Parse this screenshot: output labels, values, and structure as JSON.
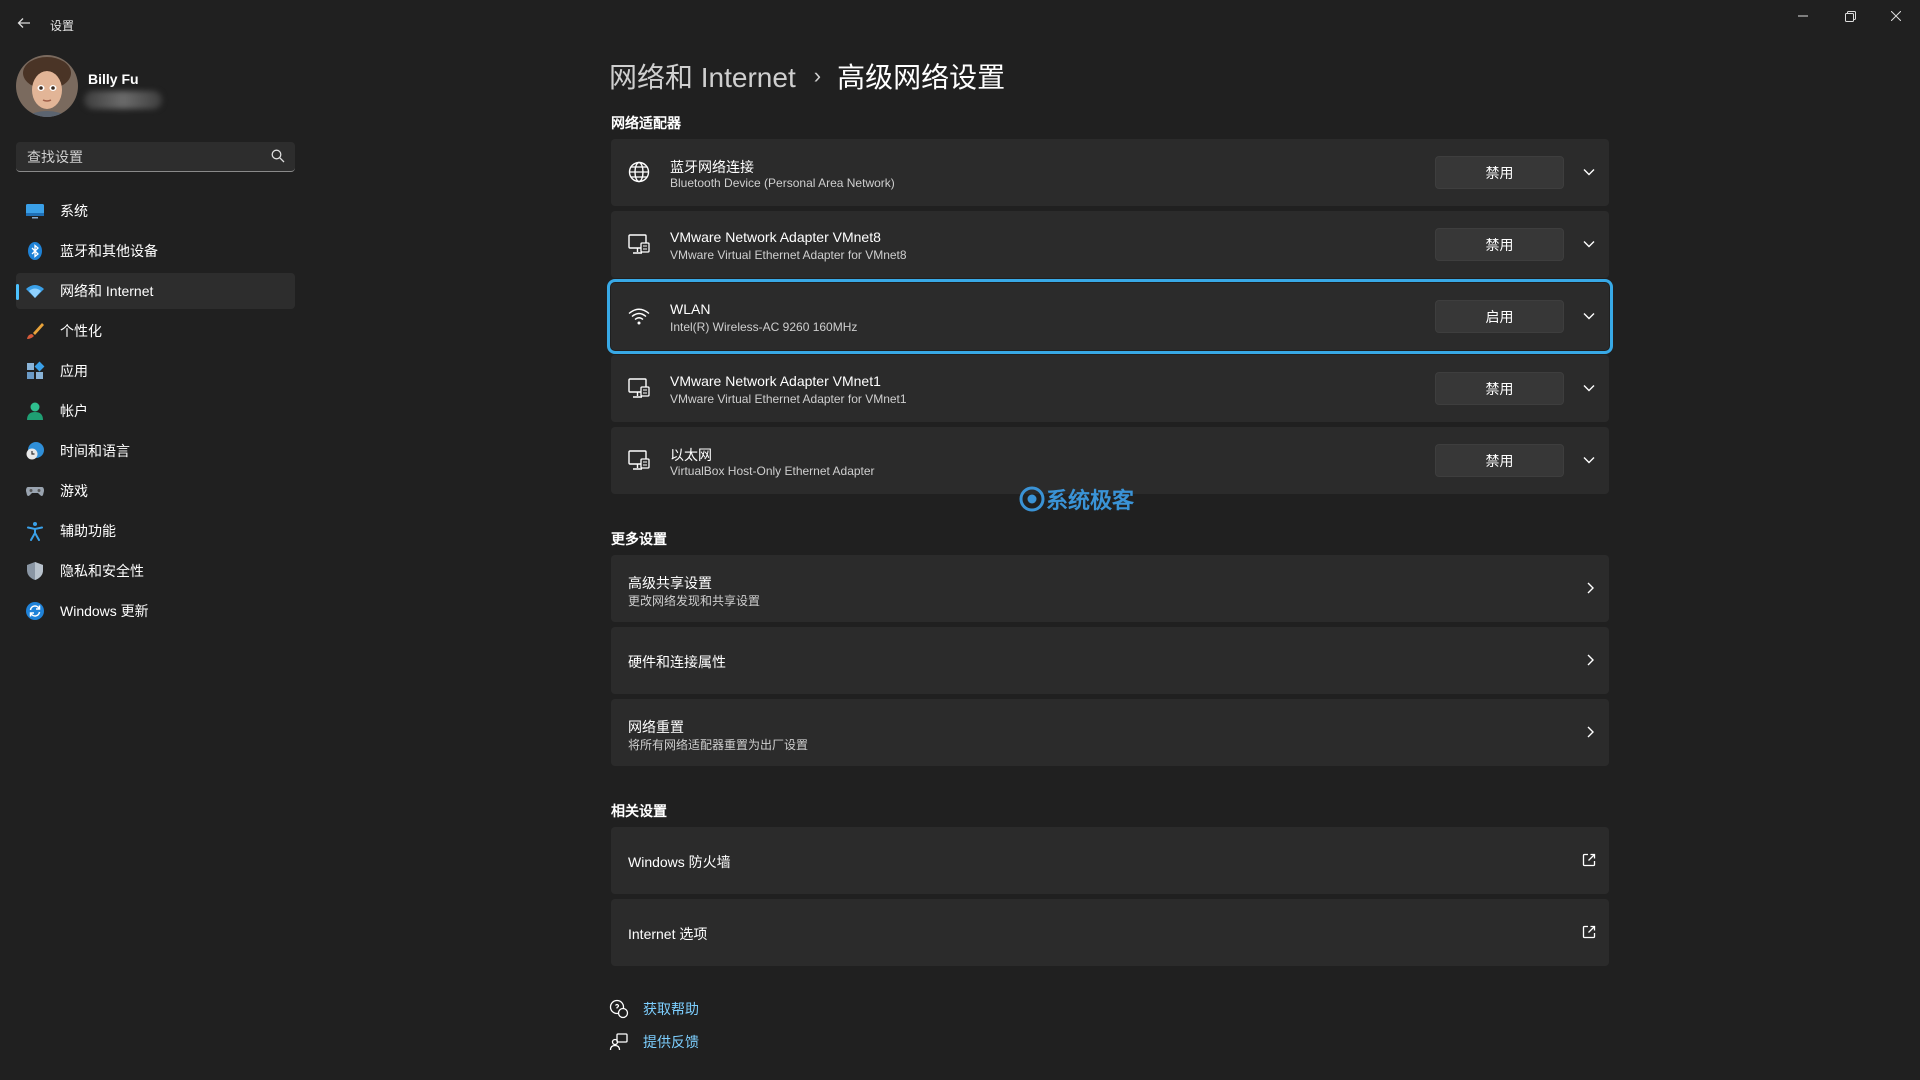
{
  "window": {
    "title": "设置",
    "back_icon": "back-arrow-icon",
    "controls": [
      "minimize-icon",
      "restore-icon",
      "close-icon"
    ]
  },
  "profile": {
    "name": "Billy Fu"
  },
  "search": {
    "placeholder": "查找设置",
    "icon": "search-icon"
  },
  "sidebar": {
    "items": [
      {
        "label": "系统",
        "icon": "monitor-icon",
        "active": false
      },
      {
        "label": "蓝牙和其他设备",
        "icon": "bluetooth-icon",
        "active": false
      },
      {
        "label": "网络和 Internet",
        "icon": "wifi-icon",
        "active": true
      },
      {
        "label": "个性化",
        "icon": "brush-icon",
        "active": false
      },
      {
        "label": "应用",
        "icon": "apps-icon",
        "active": false
      },
      {
        "label": "帐户",
        "icon": "person-icon",
        "active": false
      },
      {
        "label": "时间和语言",
        "icon": "globe-clock-icon",
        "active": false
      },
      {
        "label": "游戏",
        "icon": "gamepad-icon",
        "active": false
      },
      {
        "label": "辅助功能",
        "icon": "accessibility-icon",
        "active": false
      },
      {
        "label": "隐私和安全性",
        "icon": "shield-icon",
        "active": false
      },
      {
        "label": "Windows 更新",
        "icon": "update-icon",
        "active": false
      }
    ]
  },
  "breadcrumb": {
    "parent": "网络和 Internet",
    "separator": "›",
    "current": "高级网络设置"
  },
  "adapters": {
    "title": "网络适配器",
    "items": [
      {
        "name": "蓝牙网络连接",
        "description": "Bluetooth Device (Personal Area Network)",
        "button": "禁用",
        "icon": "globe-network-icon"
      },
      {
        "name": "VMware Network Adapter VMnet8",
        "description": "VMware Virtual Ethernet Adapter for VMnet8",
        "button": "禁用",
        "icon": "ethernet-icon"
      },
      {
        "name": "WLAN",
        "description": "Intel(R) Wireless-AC 9260 160MHz",
        "button": "启用",
        "icon": "wifi-icon"
      },
      {
        "name": "VMware Network Adapter VMnet1",
        "description": "VMware Virtual Ethernet Adapter for VMnet1",
        "button": "禁用",
        "icon": "ethernet-icon"
      },
      {
        "name": "以太网",
        "description": "VirtualBox Host-Only Ethernet Adapter",
        "button": "禁用",
        "icon": "ethernet-icon"
      }
    ]
  },
  "watermark": "系统极客",
  "more_settings": {
    "title": "更多设置",
    "items": [
      {
        "title": "高级共享设置",
        "subtitle": "更改网络发现和共享设置"
      },
      {
        "title": "硬件和连接属性",
        "subtitle": ""
      },
      {
        "title": "网络重置",
        "subtitle": "将所有网络适配器重置为出厂设置"
      }
    ]
  },
  "related_settings": {
    "title": "相关设置",
    "items": [
      {
        "title": "Windows 防火墙"
      },
      {
        "title": "Internet 选项"
      }
    ]
  },
  "help_links": {
    "get_help": "获取帮助",
    "feedback": "提供反馈"
  },
  "colors": {
    "background": "#202020",
    "card": "#2b2b2b",
    "accent": "#4cc2ff",
    "highlight_border": "#38a9e6",
    "link": "#7dcfff"
  }
}
